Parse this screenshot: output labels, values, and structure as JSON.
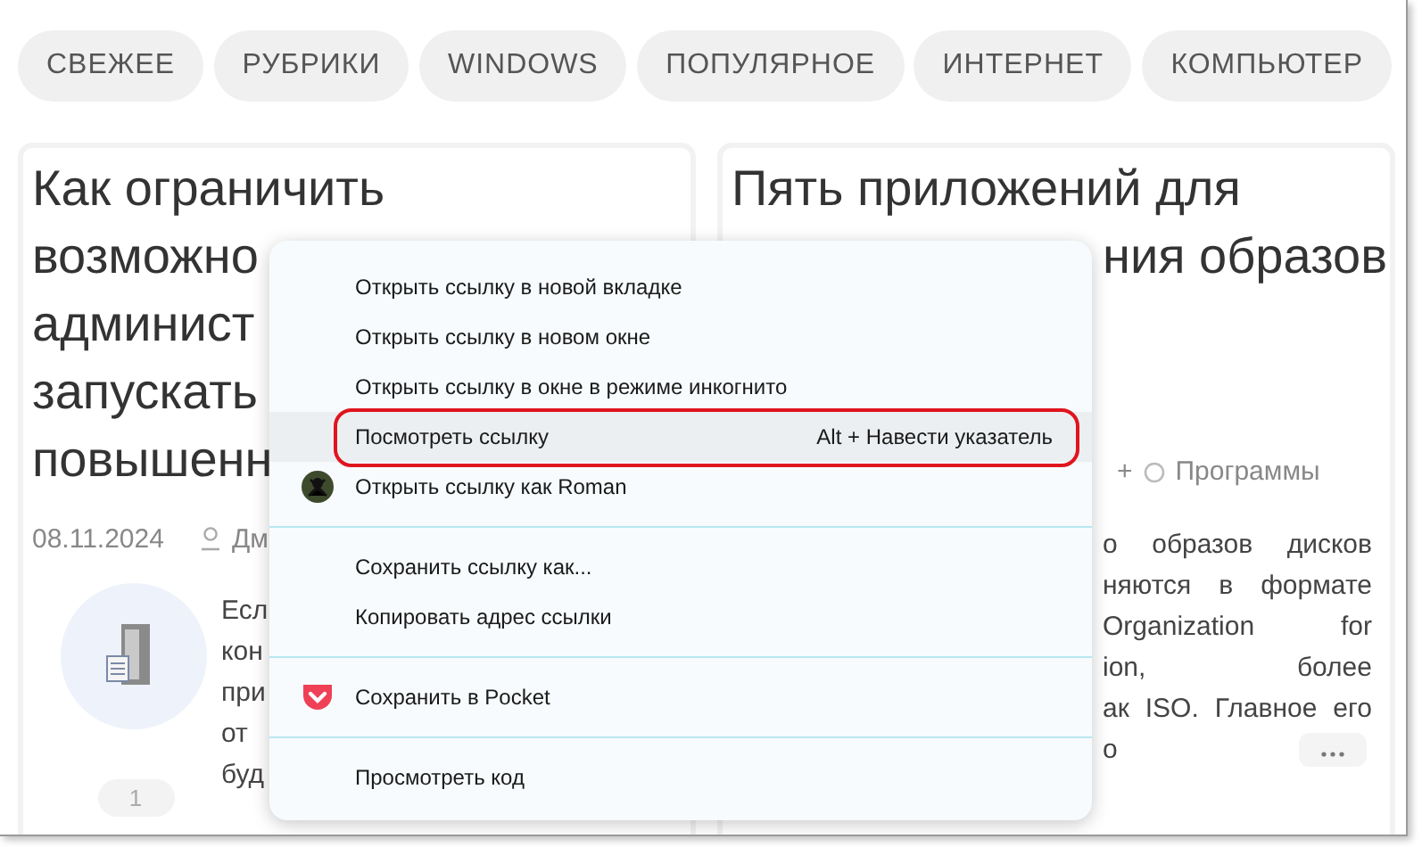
{
  "nav": [
    {
      "label": "СВЕЖЕЕ"
    },
    {
      "label": "РУБРИКИ"
    },
    {
      "label": "WINDOWS"
    },
    {
      "label": "ПОПУЛЯРНОЕ"
    },
    {
      "label": "ИНТЕРНЕТ"
    },
    {
      "label": "КОМПЬЮТЕР"
    }
  ],
  "left_card": {
    "title_lines": [
      "Как ограничить",
      "возможно",
      "админист",
      "запускать",
      "повышенн"
    ],
    "date": "08.11.2024",
    "author": "Дм",
    "excerpt_lines": [
      "Есл",
      "кон",
      "при",
      "от",
      "буд"
    ],
    "count": "1"
  },
  "right_card": {
    "title_lines": [
      "Пять приложений для",
      "ния образов"
    ],
    "categories": "+",
    "category": "Программы",
    "excerpt_lines": [
      "о образов дисков",
      "няются в формате",
      "Organization for",
      "ion,      более",
      "ак ISO. Главное его"
    ],
    "last_line": "о"
  },
  "context_menu": {
    "items": [
      {
        "kind": "item",
        "label": "Открыть ссылку в новой вкладке",
        "selected": false,
        "outlined": false
      },
      {
        "kind": "item",
        "label": "Открыть ссылку в новом окне",
        "selected": false,
        "outlined": false
      },
      {
        "kind": "item",
        "label": "Открыть ссылку в окне в режиме инкогнито",
        "selected": false,
        "outlined": false
      },
      {
        "kind": "item",
        "label": "Посмотреть ссылку",
        "shortcut": "Alt + Навести указатель",
        "selected": true,
        "outlined": true
      },
      {
        "kind": "profile",
        "label": "Открыть ссылку как Roman",
        "selected": false,
        "outlined": false
      },
      {
        "kind": "separator"
      },
      {
        "kind": "item",
        "label": "Сохранить ссылку как...",
        "selected": false,
        "outlined": false
      },
      {
        "kind": "item",
        "label": "Копировать адрес ссылки",
        "selected": false,
        "outlined": false
      },
      {
        "kind": "separator"
      },
      {
        "kind": "pocket",
        "label": "Сохранить в Pocket",
        "selected": false,
        "outlined": false
      },
      {
        "kind": "separator"
      },
      {
        "kind": "item",
        "label": "Просмотреть код",
        "selected": false,
        "outlined": false
      }
    ]
  }
}
